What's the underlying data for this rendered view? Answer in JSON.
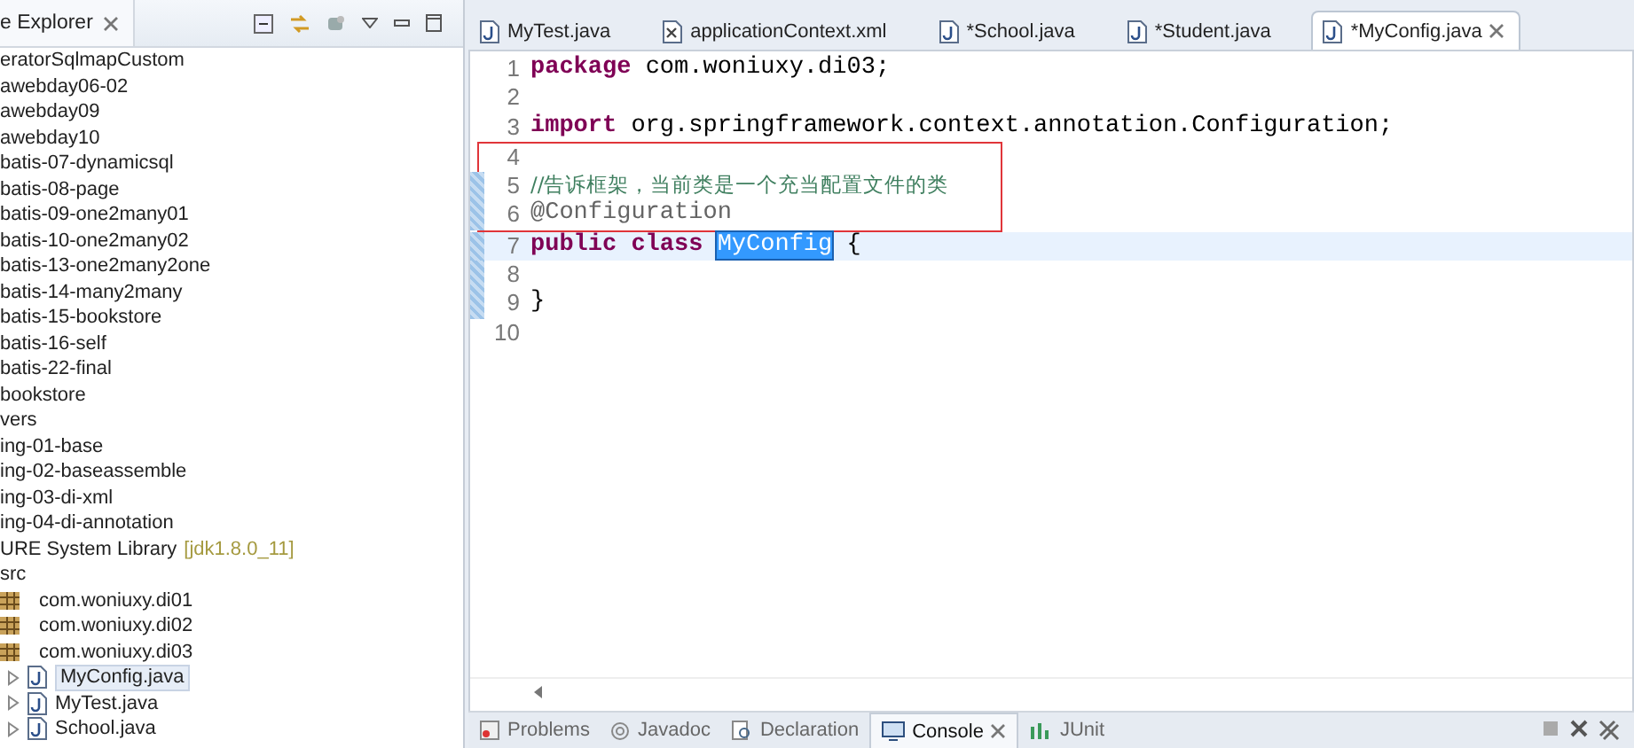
{
  "explorer": {
    "title": "e Explorer",
    "items": [
      {
        "kind": "project",
        "label": "eratorSqlmapCustom"
      },
      {
        "kind": "project",
        "label": "awebday06-02"
      },
      {
        "kind": "project",
        "label": "awebday09"
      },
      {
        "kind": "project",
        "label": "awebday10"
      },
      {
        "kind": "project",
        "label": "batis-07-dynamicsql"
      },
      {
        "kind": "project",
        "label": "batis-08-page"
      },
      {
        "kind": "project",
        "label": "batis-09-one2many01"
      },
      {
        "kind": "project",
        "label": "batis-10-one2many02"
      },
      {
        "kind": "project",
        "label": "batis-13-one2many2one"
      },
      {
        "kind": "project",
        "label": "batis-14-many2many"
      },
      {
        "kind": "project",
        "label": "batis-15-bookstore"
      },
      {
        "kind": "project",
        "label": "batis-16-self"
      },
      {
        "kind": "project",
        "label": "batis-22-final"
      },
      {
        "kind": "project",
        "label": "bookstore"
      },
      {
        "kind": "project",
        "label": "vers"
      },
      {
        "kind": "project",
        "label": "ing-01-base"
      },
      {
        "kind": "project",
        "label": "ing-02-baseassemble"
      },
      {
        "kind": "project",
        "label": "ing-03-di-xml"
      },
      {
        "kind": "project",
        "label": "ing-04-di-annotation"
      },
      {
        "kind": "project",
        "label": "URE System Library",
        "decoration": "[jdk1.8.0_11]"
      },
      {
        "kind": "project",
        "label": "src"
      },
      {
        "kind": "package",
        "label": "com.woniuxy.di01"
      },
      {
        "kind": "package",
        "label": "com.woniuxy.di02"
      },
      {
        "kind": "package",
        "label": "com.woniuxy.di03"
      },
      {
        "kind": "file",
        "label": "MyConfig.java",
        "selected": true
      },
      {
        "kind": "file",
        "label": "MyTest.java",
        "selected": false
      },
      {
        "kind": "file",
        "label": "School.java",
        "selected": false
      }
    ]
  },
  "editor": {
    "tabs": [
      {
        "label": "MyTest.java",
        "kind": "java",
        "selected": false
      },
      {
        "label": "applicationContext.xml",
        "kind": "xml",
        "selected": false
      },
      {
        "label": "*School.java",
        "kind": "java",
        "selected": false
      },
      {
        "label": "*Student.java",
        "kind": "java",
        "selected": false
      },
      {
        "label": "*MyConfig.java",
        "kind": "java",
        "selected": true
      }
    ],
    "lines": [
      {
        "number": "1",
        "changed": false,
        "current": false,
        "boxed": false,
        "tokens": [
          {
            "kind": "keyword",
            "text": "package"
          },
          {
            "kind": "plain",
            "text": " com.woniuxy.di03;"
          }
        ]
      },
      {
        "number": "2",
        "changed": false,
        "current": false,
        "boxed": false
      },
      {
        "number": "3",
        "changed": false,
        "current": false,
        "boxed": false,
        "tokens": [
          {
            "kind": "keyword",
            "text": "import"
          },
          {
            "kind": "plain",
            "text": " org.springframework.context.annotation.Configuration;"
          }
        ]
      },
      {
        "number": "4",
        "changed": false,
        "current": false,
        "boxed": true
      },
      {
        "number": "5",
        "changed": true,
        "current": false,
        "boxed": true,
        "tokens": [
          {
            "kind": "comment",
            "text": "//告诉框架，当前类是一个充当配置文件的类"
          }
        ]
      },
      {
        "number": "6",
        "changed": true,
        "current": false,
        "boxed": true,
        "tokens": [
          {
            "kind": "annotation",
            "text": "@Configuration"
          }
        ]
      },
      {
        "number": "7",
        "changed": true,
        "current": true,
        "boxed": false,
        "tokens": [
          {
            "kind": "keyword",
            "text": "public class "
          },
          {
            "kind": "selected",
            "text": "MyConfig"
          },
          {
            "kind": "plain",
            "text": " {"
          }
        ]
      },
      {
        "number": "8",
        "changed": true,
        "current": false,
        "boxed": false
      },
      {
        "number": "9",
        "changed": true,
        "current": false,
        "boxed": false,
        "tokens": [
          {
            "kind": "plain",
            "text": "}"
          }
        ]
      },
      {
        "number": "10",
        "changed": false,
        "current": false,
        "boxed": false
      }
    ]
  },
  "bottom_tabs": [
    {
      "label": "Problems",
      "selected": false
    },
    {
      "label": "Javadoc",
      "selected": false
    },
    {
      "label": "Declaration",
      "selected": false
    },
    {
      "label": "Console",
      "selected": true
    },
    {
      "label": "JUnit",
      "selected": false
    }
  ]
}
